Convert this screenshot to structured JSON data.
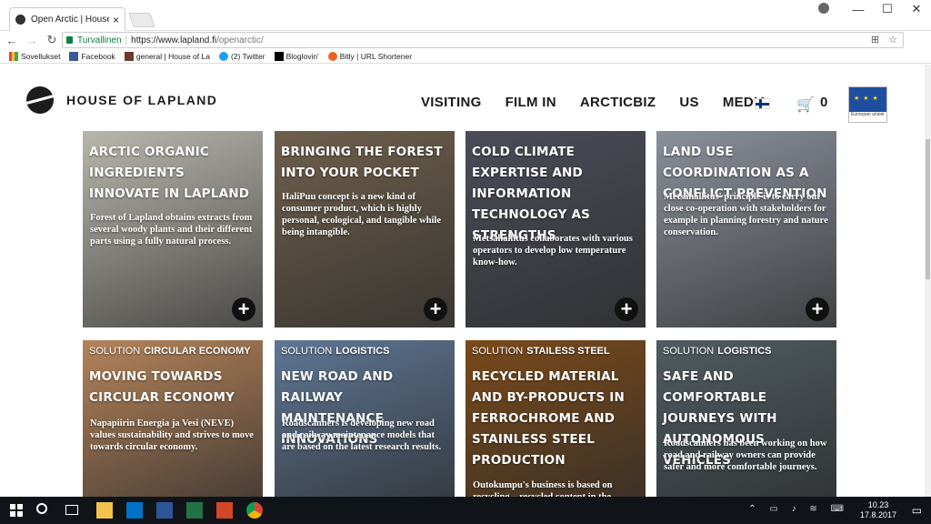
{
  "browser": {
    "tab_title": "Open Arctic | House of L",
    "tab_close": "×",
    "window_controls": [
      "—",
      "☐",
      "✕"
    ],
    "secure_label": "Turvallinen",
    "url_host": "https://www.lapland.fi",
    "url_path": "/openarctic/",
    "bookmarks": [
      "Sovellukset",
      "Facebook",
      "general | House of La",
      "(2) Twitter",
      "Bloglovin'",
      "Bitly | URL Shortener"
    ]
  },
  "site": {
    "logo": "HOUSE OF LAPLAND",
    "nav": [
      "VISITING",
      "FILM IN",
      "ARCTICBIZ",
      "US",
      "MEDIA"
    ],
    "cart_count": "0",
    "eu_caption": "Euroopan unioni"
  },
  "cards": [
    {
      "title": "ARCTIC ORGANIC INGREDIENTS INNOVATE IN LAPLAND",
      "body": "Forest of Lapland obtains extracts from several woody plants and their different parts using a fully natural process.",
      "bg": "#b8b6ac"
    },
    {
      "title": "BRINGING THE FOREST INTO YOUR POCKET",
      "body": "HaliPuu concept is a new kind of consumer product, which is highly personal, ecological, and tangible while being intangible.",
      "bg": "#6e5f4c"
    },
    {
      "title": "COLD CLIMATE EXPERTISE AND INFORMATION TECHNOLOGY AS STRENGTHS",
      "body": "Metsähallitus collaborates with various operators to develop low temperature know-how.",
      "bg": "#4a4d58"
    },
    {
      "title": "LAND USE COORDINATION AS A CONFLICT PREVENTION",
      "body": "Metsähallitus' principle is to carry out close co-operation with stakeholders for example in planning forestry and nature conservation.",
      "bg": "#8a8f9a"
    },
    {
      "solution": "SOLUTION",
      "category": "CIRCULAR ECONOMY",
      "title": "MOVING TOWARDS CIRCULAR ECONOMY",
      "body": "Napapiirin Energia ja Vesi (NEVE) values sustainability and strives to move towards circular economy.",
      "bg": "#b4835a"
    },
    {
      "solution": "SOLUTION",
      "category": "LOGISTICS",
      "title": "NEW ROAD AND RAILWAY MAINTENANCE INNOVATIONS",
      "body": "Roadscanners is developing new road and railway maintenance models that are based on the latest research results.",
      "bg": "#5e7694"
    },
    {
      "solution": "SOLUTION",
      "category": "STAILESS STEEL",
      "title": "RECYCLED MATERIAL AND BY-PRODUCTS IN FERROCHROME AND STAINLESS STEEL PRODUCTION",
      "body": "Outokumpu's business is based on recycling – recycled content in the",
      "bg": "#7a4a1a"
    },
    {
      "solution": "SOLUTION",
      "category": "LOGISTICS",
      "title": "SAFE AND COMFORTABLE JOURNEYS WITH AUTONOMOUS VEHICLES",
      "body": "Roadscanners has been working on how road and railway owners can provide safer and more comfortable journeys.",
      "bg": "#4f5c62"
    }
  ],
  "taskbar": {
    "time": "10.23",
    "date": "17.8.2017"
  }
}
